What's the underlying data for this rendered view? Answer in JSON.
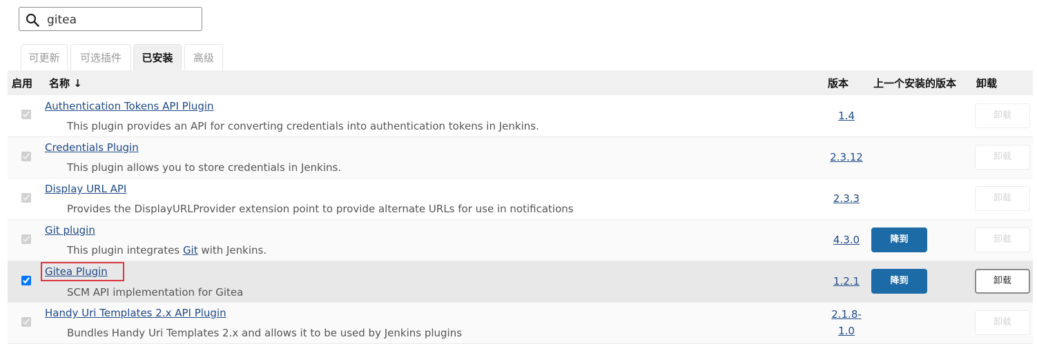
{
  "search": {
    "value": "gitea",
    "placeholder": ""
  },
  "tabs": [
    {
      "label": "可更新",
      "active": false
    },
    {
      "label": "可选插件",
      "active": false
    },
    {
      "label": "已安装",
      "active": true
    },
    {
      "label": "高级",
      "active": false
    }
  ],
  "table": {
    "headers": {
      "enabled": "启用",
      "name": "名称 ↓",
      "version": "版本",
      "previous_version": "上一个安装的版本",
      "uninstall": "卸载"
    },
    "rows": [
      {
        "name": "Authentication Tokens API Plugin",
        "description": "This plugin provides an API for converting credentials into authentication tokens in Jenkins.",
        "version": "1.4",
        "checked": true,
        "downgrade": "",
        "uninstall": "卸载"
      },
      {
        "name": "Credentials Plugin",
        "description": "This plugin allows you to store credentials in Jenkins.",
        "version": "2.3.12",
        "checked": true,
        "downgrade": "",
        "uninstall": "卸载"
      },
      {
        "name": "Display URL API",
        "description": "Provides the DisplayURLProvider extension point to provide alternate URLs for use in notifications",
        "version": "2.3.3",
        "checked": true,
        "downgrade": "",
        "uninstall": "卸载"
      },
      {
        "name": "Git plugin",
        "description_before": "This plugin integrates ",
        "description_link": "Git",
        "description_after": " with Jenkins.",
        "version": "4.3.0",
        "checked": true,
        "downgrade": "降到",
        "uninstall": "卸载"
      },
      {
        "name": "Gitea Plugin",
        "description": "SCM API implementation for Gitea",
        "version": "1.2.1",
        "checked": true,
        "downgrade": "降到",
        "uninstall": "卸载"
      },
      {
        "name": "Handy Uri Templates 2.x API Plugin",
        "description": "Bundles Handy Uri Templates 2.x and allows it to be used by Jenkins plugins",
        "version_line1": "2.1.8-",
        "version_line2": "1.0",
        "checked": true,
        "downgrade": "",
        "uninstall": "卸载"
      }
    ]
  },
  "colors": {
    "link": "#204a87",
    "button": "#1c6aa6",
    "highlight_box": "#d9363e",
    "header_bg": "#f0f0f0"
  }
}
